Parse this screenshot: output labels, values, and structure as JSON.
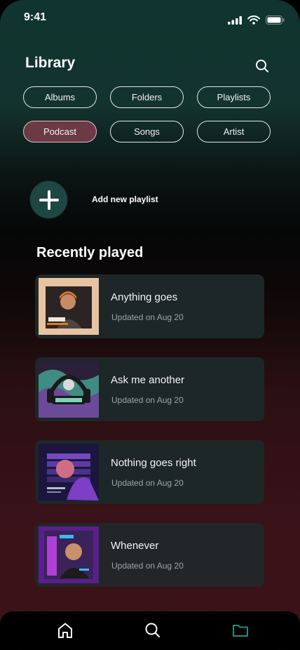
{
  "status": {
    "time": "9:41"
  },
  "header": {
    "title": "Library"
  },
  "filters": [
    {
      "label": "Albums",
      "active": false
    },
    {
      "label": "Folders",
      "active": false
    },
    {
      "label": "Playlists",
      "active": false
    },
    {
      "label": "Podcast",
      "active": true
    },
    {
      "label": "Songs",
      "active": false
    },
    {
      "label": "Artist",
      "active": false
    }
  ],
  "add_playlist": {
    "label": "Add new playlist"
  },
  "recent": {
    "title": "Recently played",
    "items": [
      {
        "title": "Anything goes",
        "subtitle": "Updated on Aug 20"
      },
      {
        "title": "Ask me another",
        "subtitle": "Updated on Aug 20"
      },
      {
        "title": "Nothing goes right",
        "subtitle": "Updated on Aug 20"
      },
      {
        "title": "Whenever",
        "subtitle": "Updated on Aug 20"
      }
    ]
  },
  "tabbar": {
    "active": "library",
    "icons": [
      "home-icon",
      "search-icon",
      "folder-icon"
    ]
  },
  "colors": {
    "accent": "#1e4744",
    "active_chip": "#6b3a44",
    "card": "#1d2727"
  }
}
